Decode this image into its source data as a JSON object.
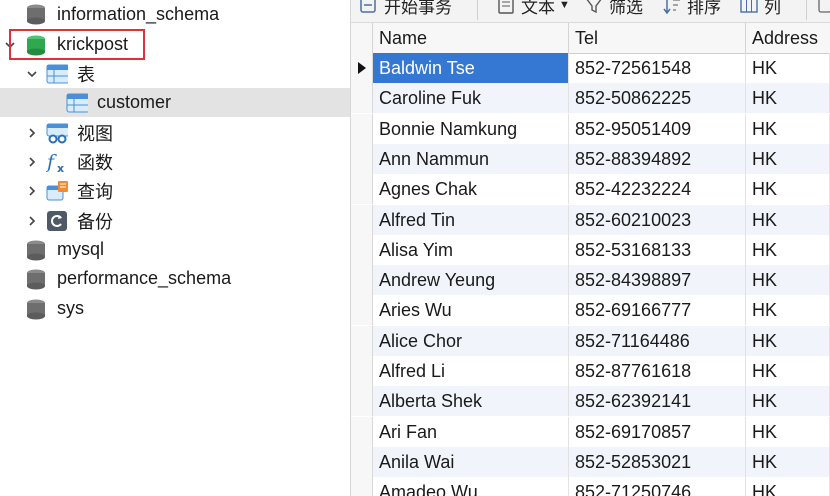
{
  "tree": {
    "items": [
      {
        "label": "information_schema",
        "icon": "database-icon-gray"
      },
      {
        "label": "krickpost",
        "icon": "database-icon-green",
        "expanded": true
      },
      {
        "label": "表",
        "icon": "tables-folder-icon",
        "expanded": true
      },
      {
        "label": "customer",
        "icon": "table-icon",
        "selected": true
      },
      {
        "label": "视图",
        "icon": "views-folder-icon"
      },
      {
        "label": "函数",
        "icon": "functions-folder-icon"
      },
      {
        "label": "查询",
        "icon": "queries-folder-icon"
      },
      {
        "label": "备份",
        "icon": "backups-folder-icon"
      },
      {
        "label": "mysql",
        "icon": "database-icon-gray"
      },
      {
        "label": "performance_schema",
        "icon": "database-icon-gray"
      },
      {
        "label": "sys",
        "icon": "database-icon-gray"
      }
    ]
  },
  "toolbar": {
    "begin_transaction": "开始事务",
    "text": "文本",
    "filter": "筛选",
    "sort": "排序",
    "columns": "列"
  },
  "grid": {
    "columns": [
      "Name",
      "Tel",
      "Address"
    ],
    "rows": [
      {
        "name": "Baldwin Tse",
        "tel": "852-72561548",
        "address": "HK"
      },
      {
        "name": "Caroline Fuk",
        "tel": "852-50862225",
        "address": "HK"
      },
      {
        "name": "Bonnie Namkung",
        "tel": "852-95051409",
        "address": "HK"
      },
      {
        "name": "Ann Nammun",
        "tel": "852-88394892",
        "address": "HK"
      },
      {
        "name": "Agnes Chak",
        "tel": "852-42232224",
        "address": "HK"
      },
      {
        "name": "Alfred Tin",
        "tel": "852-60210023",
        "address": "HK"
      },
      {
        "name": "Alisa Yim",
        "tel": "852-53168133",
        "address": "HK"
      },
      {
        "name": "Andrew Yeung",
        "tel": "852-84398897",
        "address": "HK"
      },
      {
        "name": "Aries Wu",
        "tel": "852-69166777",
        "address": "HK"
      },
      {
        "name": "Alice Chor",
        "tel": "852-71164486",
        "address": "HK"
      },
      {
        "name": "Alfred Li",
        "tel": "852-87761618",
        "address": "HK"
      },
      {
        "name": "Alberta Shek",
        "tel": "852-62392141",
        "address": "HK"
      },
      {
        "name": "Ari Fan",
        "tel": "852-69170857",
        "address": "HK"
      },
      {
        "name": "Anila Wai",
        "tel": "852-52853021",
        "address": "HK"
      },
      {
        "name": "Amadeo Wu",
        "tel": "852-71250746",
        "address": "HK"
      }
    ]
  },
  "colors": {
    "selection": "#3478d4",
    "highlight_box": "#e0303a",
    "db_active": "#2fa84f",
    "db_inactive": "#6e6e6e"
  }
}
